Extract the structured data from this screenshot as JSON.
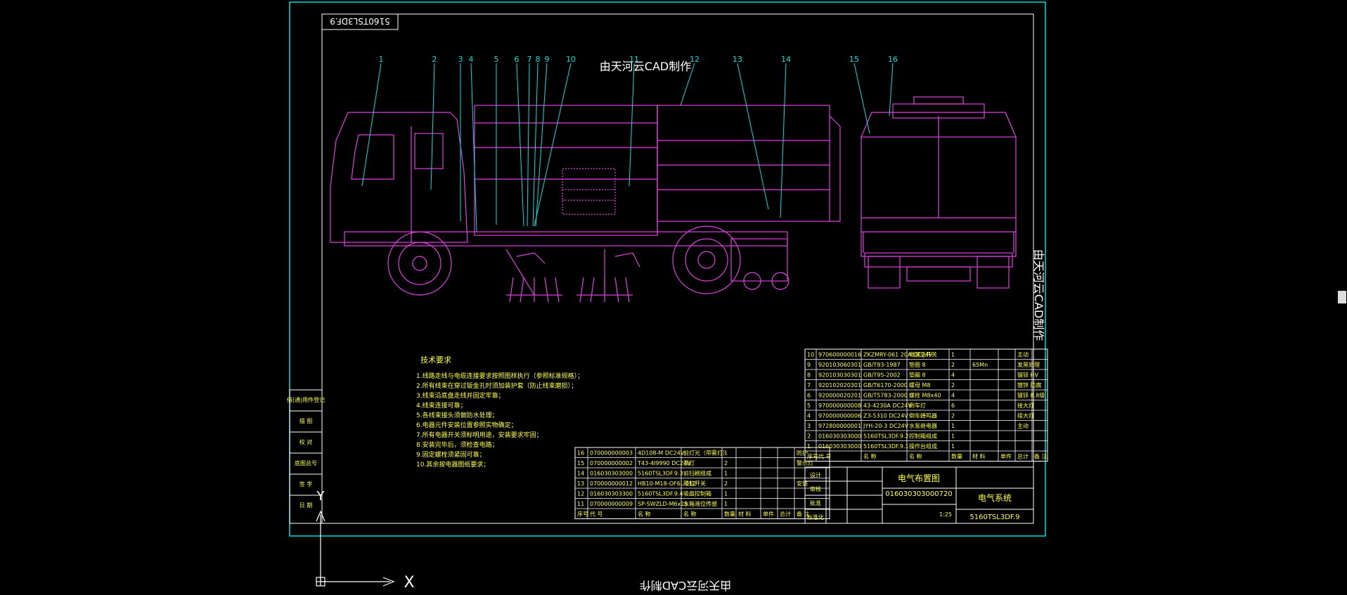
{
  "drawing": {
    "title_stamp": "5160TSL3DF.9",
    "watermark": "由天河云CAD制作",
    "callouts": [
      "1",
      "2",
      "3",
      "4",
      "5",
      "6",
      "7",
      "8",
      "9",
      "10",
      "11",
      "12",
      "13",
      "14",
      "15",
      "16"
    ]
  },
  "notes": {
    "title": "技术要求",
    "lines": [
      "1.线路走线与电缆连接要求按照图样执行（参照标准规格）；",
      "2.所有线束在穿过钣金孔时须加装护套（防止线束磨损）；",
      "3.线束沿底盘走线并固定牢靠；",
      "4.线束连接可靠；",
      "5.各线束接头须做防水处理；",
      "6.电器元件安装位置参照实物确定；",
      "7.所有电器开关须标明用途，安装要求牢固；",
      "8.安装完毕后，须检查电路；",
      "9.固定螺栓须紧固可靠；",
      "10.其余按电器图纸要求；"
    ]
  },
  "left_strip": [
    "借(通)用件登记",
    "描 图",
    "校 对",
    "底图总号",
    "签 字",
    "日 期"
  ],
  "bom_left": [
    [
      "16",
      "070000000003",
      "4D108-M DC24V",
      "前灯光（带雾灯）",
      "1",
      "",
      "",
      "",
      "防护"
    ],
    [
      "15",
      "070000000002",
      "T43-4I9990 DC24V",
      "顶灯",
      "2",
      "",
      "",
      "",
      "警示灯"
    ],
    [
      "14",
      "016030303000",
      "5160TSL3DF.9.3",
      "前扫刷组成",
      "1",
      "",
      "",
      "",
      ""
    ],
    [
      "13",
      "070000000012",
      "HB10-M18-OF6L-012",
      "限位开关",
      "2",
      "",
      "",
      "",
      "安装"
    ],
    [
      "12",
      "016030303300",
      "5160TSL3DF.9.4",
      "吸盘控制箱",
      "1",
      "",
      "",
      "",
      ""
    ],
    [
      "11",
      "070000000009",
      "SP-SWZLD-M6x15",
      "水箱液位传感",
      "1",
      "",
      "",
      "",
      ""
    ]
  ],
  "bom_left_header": [
    "序号",
    "代 号",
    "名 称",
    "名 称",
    "数量",
    "材 料",
    "单件",
    "总计",
    "备 注"
  ],
  "bom_right": [
    [
      "10",
      "970600000016",
      "ZKZMRY-061 20A DC24V",
      "电源总开关",
      "1",
      "",
      "",
      "主动"
    ],
    [
      "9",
      "920103060301",
      "GB/T93-1987",
      "垫圈 8",
      "2",
      "65Mn",
      "",
      "发黑处理"
    ],
    [
      "8",
      "920103030301",
      "GB/T95-2002",
      "垫圈 8",
      "4",
      "",
      "",
      "镀锌 HV"
    ],
    [
      "7",
      "920102020301",
      "GB/T6170-2000",
      "螺母 M8",
      "2",
      "",
      "",
      "镀锌 防腐"
    ],
    [
      "6",
      "920000020201",
      "GB/T5783-2000",
      "螺栓 M8x40",
      "4",
      "",
      "",
      "镀锌 8.8级"
    ],
    [
      "5",
      "970000000008",
      "43-4230A DC24V",
      "倒车灯",
      "6",
      "",
      "",
      "接大灯"
    ],
    [
      "4",
      "970000000006",
      "Z3-5310 DC24V",
      "倒车蜂鸣器",
      "2",
      "",
      "",
      "接大灯"
    ],
    [
      "3",
      "972800000001",
      "JYH-20-3 DC24V",
      "水泵继电器",
      "1",
      "",
      "",
      "主动"
    ],
    [
      "2",
      "016030303000",
      "5160TSL3DF.9.2",
      "控制箱组成",
      "1",
      "",
      "",
      ""
    ],
    [
      "1",
      "016030303000",
      "5160TSL3DF.9.1",
      "操作台组成",
      "1",
      "",
      "",
      ""
    ]
  ],
  "bom_right_header": [
    "序号",
    "代 号",
    "名 称",
    "名 称",
    "数量",
    "材 料",
    "单件",
    "总计",
    "备 注"
  ],
  "title_block": {
    "drawing_name": "电气布置图",
    "drawing_code": "016030303000720",
    "system": "电气系统",
    "model": "5160TSL3DF.9",
    "scale": "1:25",
    "design": "设计",
    "check": "审核",
    "approve": "批准",
    "standard": "标准化"
  },
  "ucs": {
    "x_label": "X",
    "y_label": "Y"
  },
  "colors": {
    "background": "#000000",
    "border": "#00dcdc",
    "frame": "#ffffff",
    "vehicle": "#e040e0",
    "callout": "#00e0e0",
    "text": "#ffff40",
    "label": "#ffffff"
  }
}
